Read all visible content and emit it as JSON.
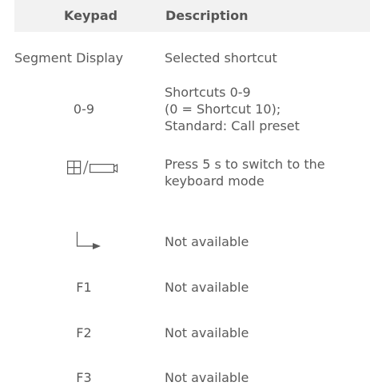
{
  "header": {
    "keypad": "Keypad",
    "description": "Description"
  },
  "rows": [
    {
      "key": "Segment Display",
      "desc": [
        "Selected shortcut"
      ]
    },
    {
      "key": "0-9",
      "desc": [
        "Shortcuts 0-9",
        "(0 = Shortcut 10);",
        "Standard: Call preset"
      ]
    },
    {
      "key_icon": "grid-camera-toggle-icon",
      "desc": [
        "Press 5 s to switch to the",
        "keyboard mode"
      ]
    },
    {
      "key_icon": "enter-arrow-icon",
      "desc": [
        "Not available"
      ]
    },
    {
      "key": "F1",
      "desc": [
        "Not available"
      ]
    },
    {
      "key": "F2",
      "desc": [
        "Not available"
      ]
    },
    {
      "key": "F3",
      "desc": [
        "Not available"
      ]
    }
  ]
}
